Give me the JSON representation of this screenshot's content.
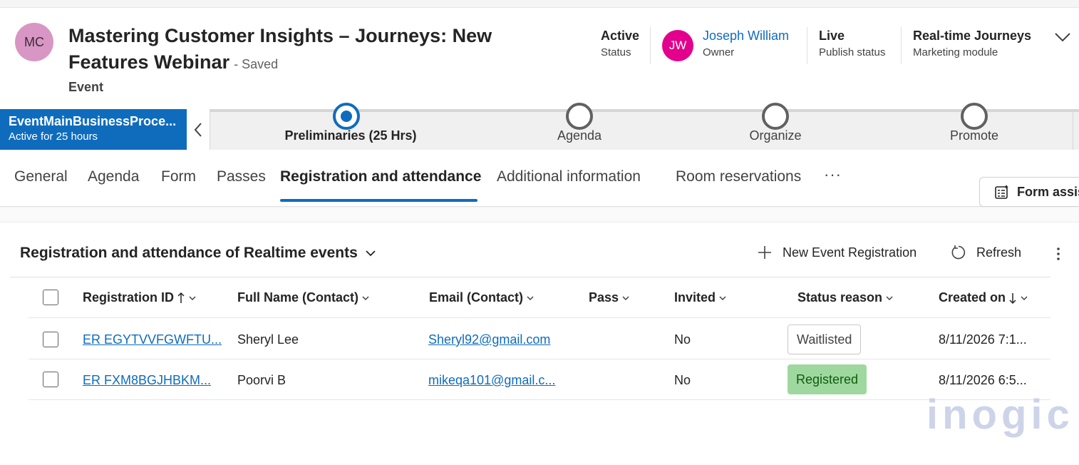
{
  "header": {
    "avatar_initials": "MC",
    "title": "Mastering Customer Insights – Journeys: New Features Webinar",
    "saved_label": "- Saved",
    "entity_type": "Event",
    "fields": [
      {
        "value": "Active",
        "label": "Status"
      },
      {
        "value": "Joseph William",
        "label": "Owner",
        "avatar_initials": "JW"
      },
      {
        "value": "Live",
        "label": "Publish status"
      },
      {
        "value": "Real-time Journeys",
        "label": "Marketing module"
      }
    ]
  },
  "bpf": {
    "process_name": "EventMainBusinessProce...",
    "active_for": "Active for 25 hours",
    "stages": [
      {
        "label": "Preliminaries  (25 Hrs)",
        "active": true
      },
      {
        "label": "Agenda",
        "active": false
      },
      {
        "label": "Organize",
        "active": false
      },
      {
        "label": "Promote",
        "active": false
      }
    ]
  },
  "tabs": [
    "General",
    "Agenda",
    "Form",
    "Passes",
    "Registration and attendance",
    "Additional information",
    "Room reservations"
  ],
  "active_tab": "Registration and attendance",
  "more_tabs": "···",
  "form_assist_label": "Form assis",
  "subgrid": {
    "title": "Registration and attendance of Realtime events",
    "commands": {
      "new": "New Event Registration",
      "refresh": "Refresh"
    },
    "columns": [
      "Registration ID",
      "Full Name (Contact)",
      "Email (Contact)",
      "Pass",
      "Invited",
      "Status reason",
      "Created on"
    ],
    "rows": [
      {
        "id": "ER EGYTVVFGWFTU...",
        "name": "Sheryl Lee",
        "email": "Sheryl92@gmail.com",
        "pass": "",
        "invited": "No",
        "status": "Waitlisted",
        "created": "8/11/2026 7:1..."
      },
      {
        "id": "ER FXM8BGJHBKM...",
        "name": "Poorvi B",
        "email": "mikeqa101@gmail.c...",
        "pass": "",
        "invited": "No",
        "status": "Registered",
        "created": "8/11/2026 6:5..."
      }
    ]
  },
  "watermark": "inogic",
  "colors": {
    "accent": "#0f6cbd",
    "owner_avatar": "#e3008c",
    "record_avatar": "#d896c4",
    "registered_bg": "#9fd89f"
  }
}
